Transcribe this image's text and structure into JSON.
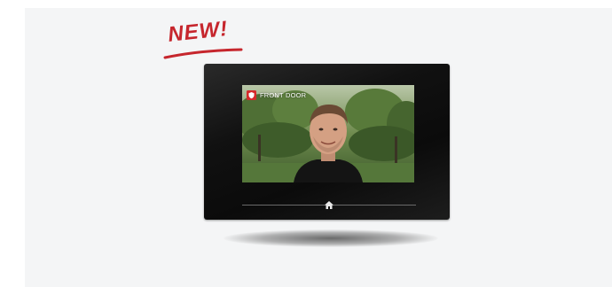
{
  "badge": {
    "text": "NEW!",
    "color": "#c6262d"
  },
  "device": {
    "camera_label": "FRONT DOOR",
    "camera_icon": "camera-shield-icon",
    "home_icon": "home-icon",
    "accent": "#d62b2b"
  }
}
